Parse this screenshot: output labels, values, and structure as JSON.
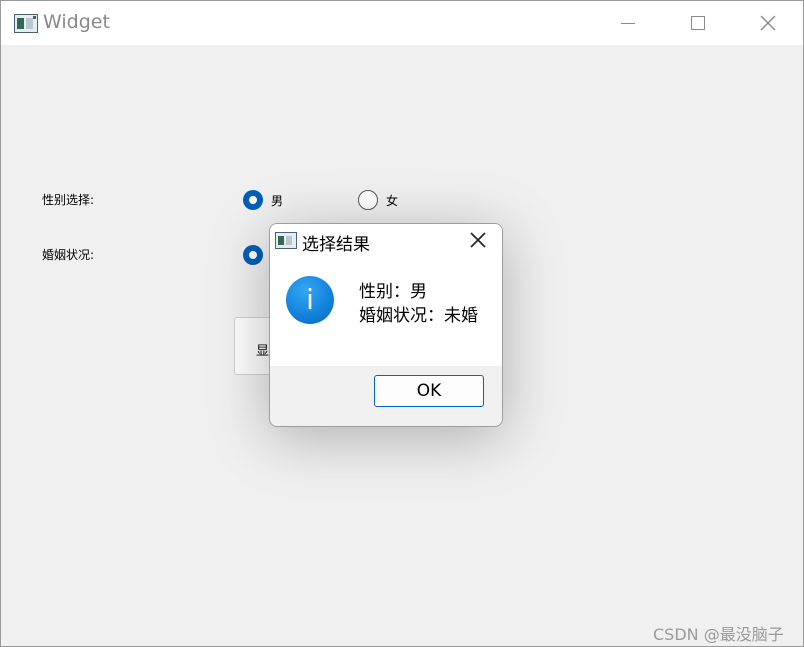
{
  "window": {
    "title": "Widget",
    "controls": {
      "minimize": "minimize-icon",
      "maximize": "maximize-icon",
      "close": "close-icon"
    }
  },
  "form": {
    "gender_label": "性别选择:",
    "gender_options": [
      {
        "label": "男",
        "checked": true
      },
      {
        "label": "女",
        "checked": false
      }
    ],
    "marital_label": "婚姻状况:",
    "marital_selected_checked": true,
    "show_button_label": "显"
  },
  "dialog": {
    "title": "选择结果",
    "icon": "info-icon",
    "icon_glyph": "i",
    "message_line1": "性别：男",
    "message_line2": "婚姻状况：未婚",
    "ok_label": "OK"
  },
  "watermark": "CSDN @最没脑子",
  "colors": {
    "accent": "#005fb8",
    "info_blue": "#1384dd",
    "window_bg": "#f0f0f0"
  }
}
